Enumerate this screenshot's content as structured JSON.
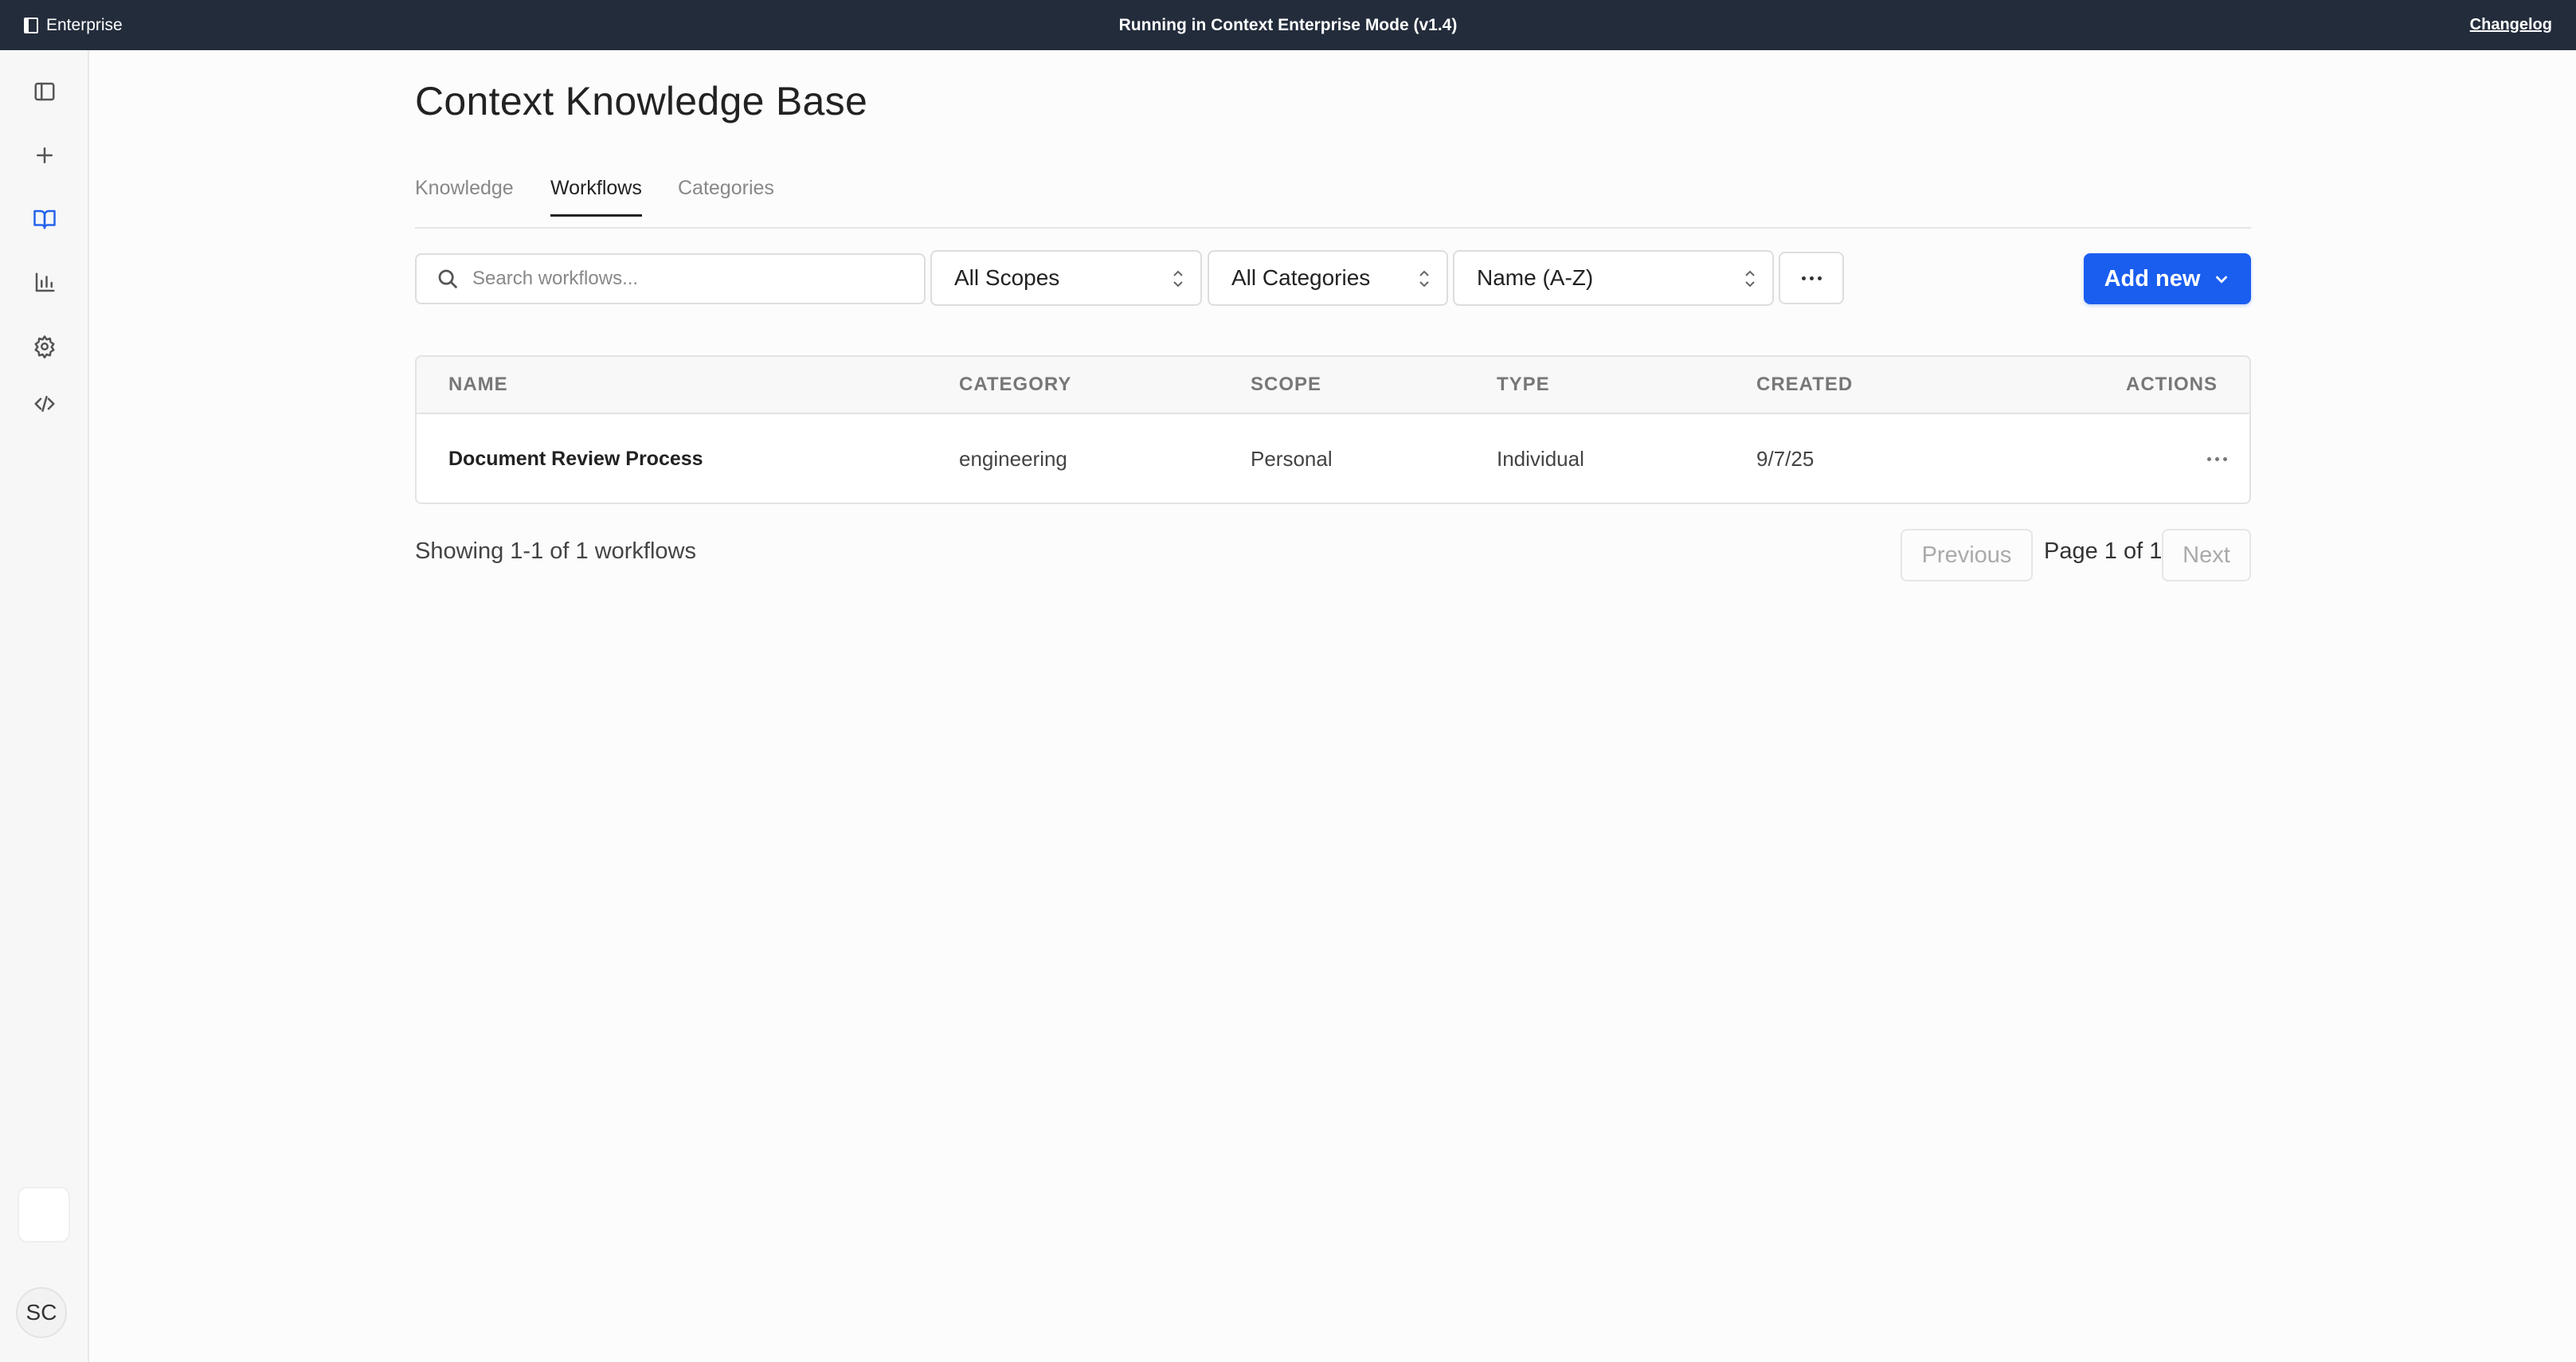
{
  "topbar": {
    "brand": "Enterprise",
    "mode_text": "Running in Context Enterprise Mode (v1.4)",
    "changelog": "Changelog"
  },
  "sidebar": {
    "items": [
      {
        "icon": "sidebar-toggle-icon"
      },
      {
        "icon": "plus-icon"
      },
      {
        "icon": "book-icon",
        "active": true
      },
      {
        "icon": "bar-chart-icon"
      },
      {
        "icon": "gear-icon"
      },
      {
        "icon": "code-icon"
      }
    ],
    "avatar": "SC"
  },
  "page": {
    "title": "Context Knowledge Base",
    "tabs": [
      "Knowledge",
      "Workflows",
      "Categories"
    ],
    "active_tab": "Workflows"
  },
  "filters": {
    "search_placeholder": "Search workflows...",
    "scope": "All Scopes",
    "category": "All Categories",
    "sort": "Name (A-Z)",
    "add_new": "Add new"
  },
  "table": {
    "headers": [
      "NAME",
      "CATEGORY",
      "SCOPE",
      "TYPE",
      "CREATED",
      "ACTIONS"
    ],
    "rows": [
      {
        "name": "Document Review Process",
        "category": "engineering",
        "scope": "Personal",
        "type": "Individual",
        "created": "9/7/25"
      }
    ]
  },
  "pagination": {
    "showing": "Showing 1-1 of 1 workflows",
    "previous": "Previous",
    "page_info": "Page 1 of 1",
    "next": "Next"
  },
  "colors": {
    "accent": "#1a5ef0",
    "topbar": "#232c3b"
  }
}
